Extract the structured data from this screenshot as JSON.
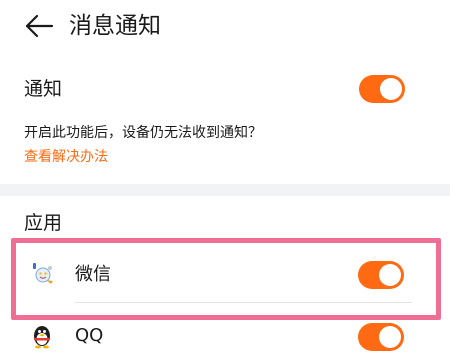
{
  "header": {
    "title": "消息通知"
  },
  "notification": {
    "label": "通知",
    "enabled": true,
    "description": "开启此功能后，设备仍无法收到通知？",
    "help_link": "查看解决办法"
  },
  "apps": {
    "section_label": "应用",
    "items": [
      {
        "name": "微信",
        "icon": "wechat-icon",
        "enabled": true
      },
      {
        "name": "QQ",
        "icon": "qq-penguin-icon",
        "enabled": true
      }
    ]
  },
  "colors": {
    "accent": "#ff6a13",
    "highlight": "#ee6e96",
    "background": "#f1f3f5"
  }
}
